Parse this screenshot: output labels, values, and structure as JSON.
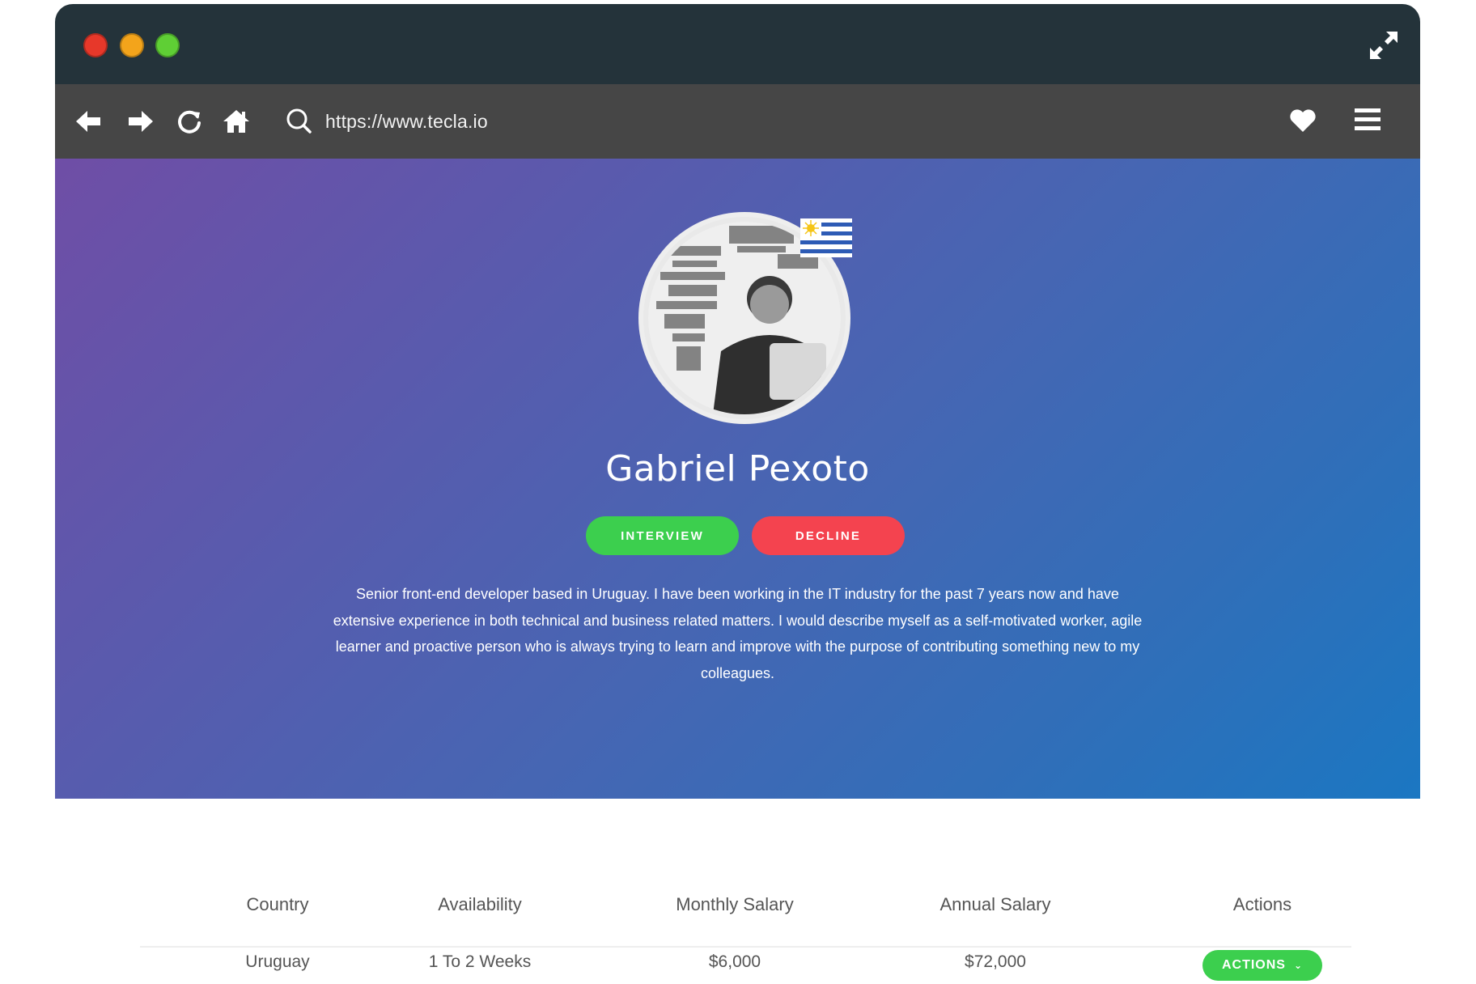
{
  "window": {
    "controls": [
      "close",
      "minimize",
      "zoom"
    ],
    "expand_icon": "expand-arrows-icon"
  },
  "toolbar": {
    "back_icon": "arrow-left-icon",
    "forward_icon": "arrow-right-icon",
    "reload_icon": "reload-icon",
    "home_icon": "home-icon",
    "search_icon": "search-icon",
    "url": "https://www.tecla.io",
    "favorite_icon": "heart-icon",
    "menu_icon": "hamburger-menu-icon"
  },
  "profile": {
    "name": "Gabriel Pexoto",
    "flag": "uruguay-flag-icon",
    "interview_label": "INTERVIEW",
    "decline_label": "DECLINE",
    "bio": "Senior front-end developer based in Uruguay. I have been working in the IT industry for the past 7 years now and have extensive experience in both technical and business related matters. I would describe myself as a self-motivated worker, agile learner and proactive person who is always trying to learn and improve with the purpose of contributing something new to my colleagues."
  },
  "colors": {
    "titlebar": "#24333a",
    "navbar": "#464646",
    "gradient_start": "#6f4ea6",
    "gradient_end": "#1b77c2",
    "interview": "#3ccf4e",
    "decline": "#f4434f"
  },
  "table": {
    "headers": [
      "Country",
      "Availability",
      "Monthly Salary",
      "Annual Salary",
      "Actions"
    ],
    "rows": [
      {
        "country": "Uruguay",
        "availability": "1 To 2 Weeks",
        "monthly_salary": "$6,000",
        "annual_salary": "$72,000",
        "actions_label": "ACTIONS"
      }
    ]
  }
}
